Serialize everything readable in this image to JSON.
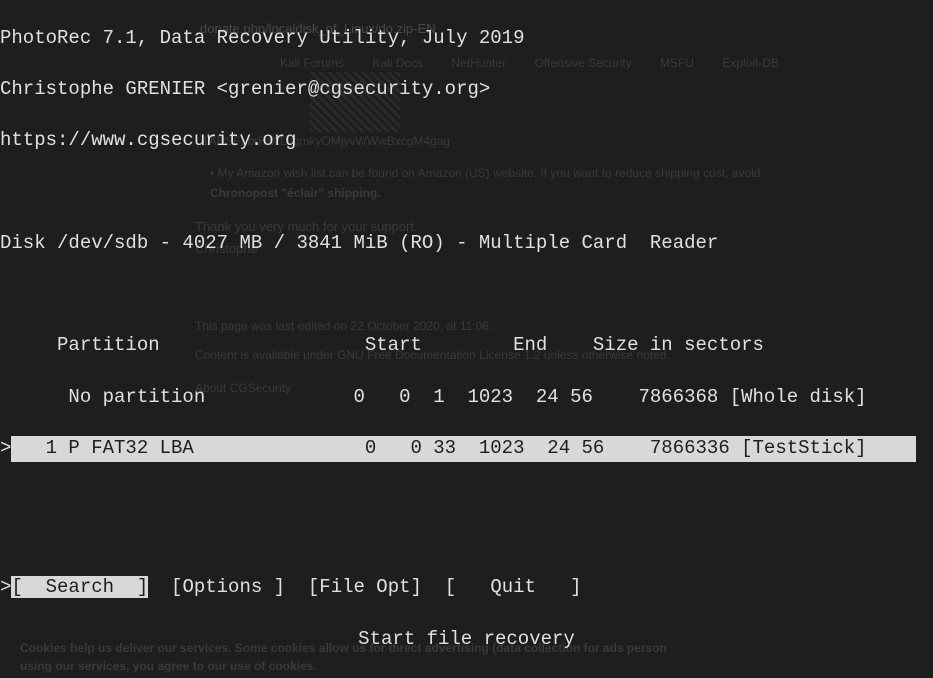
{
  "header": {
    "title": "PhotoRec 7.1, Data Recovery Utility, July 2019",
    "author": "Christophe GRENIER <grenier@cgsecurity.org>",
    "url": "https://www.cgsecurity.org"
  },
  "disk": {
    "line": "Disk /dev/sdb - 4027 MB / 3841 MiB (RO) - Multiple Card  Reader"
  },
  "table": {
    "header": "     Partition                  Start        End    Size in sectors",
    "rows": [
      "      No partition             0   0  1  1023  24 56    7866368 [Whole disk]",
      "   1 P FAT32 LBA               0   0 33  1023  24 56    7866336 [TestStick]"
    ]
  },
  "menu": {
    "cursor": ">",
    "search": "[  Search  ]",
    "options": "[Options ]",
    "fileopt": "[File Opt]",
    "quit": "[   Quit   ]"
  },
  "hint": "Start file recovery",
  "background": {
    "topurl": "donate.php/localdisk_of_Linux/do.zip-EN",
    "navitems": {
      "forums": "Kali Forums",
      "docs": "Kali Docs",
      "nethunter": "NetHunter",
      "offensive": "Offensive Security",
      "msfu": "MSFU",
      "exploit": "Exploit-DB"
    },
    "btc": "1ARSFLbrHdftLvqmkyOMjyvWWwBxcgM4gag",
    "amazon": "• My Amazon wish list can be found on Amazon (US) website. If you want to reduce shipping cost, avoid",
    "chronopost": "Chronopost \"éclair\" shipping.",
    "thanks": "Thank you very much for your support.",
    "christophe": "Christophe",
    "lastedit": "This page was last edited on 22 October 2020, at 11:06.",
    "license": "Content is available under GNU Free Documentation License 1.2 unless otherwise noted.",
    "about": "About CGSecurity",
    "cookie1": "Cookies help us deliver our services. Some cookies allow us for direct advertising (data collection for ads person",
    "cookie2": "using our services, you agree to our use of cookies."
  }
}
